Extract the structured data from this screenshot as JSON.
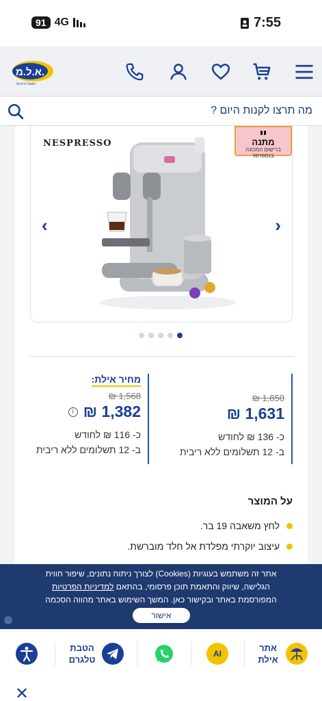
{
  "status_bar": {
    "battery": "91",
    "network": "4G",
    "time": "7:55"
  },
  "header": {
    "logo_text": "א.ל.מ.",
    "logo_subtext": "חשמל ודיגיטל",
    "brand_color": "#1a3f96",
    "accent_color": "#f3c200"
  },
  "search": {
    "placeholder": "מה תרצו לקנות היום ?"
  },
  "product": {
    "brand": "NESPRESSO",
    "gift_title": "מתנה",
    "gift_line1": "ברישום המכונה",
    "gift_line2": "בנספרסו!",
    "carousel_dots": 5,
    "active_dot": 4,
    "regular_price": {
      "old": "1,850 ₪",
      "new": "1,631 ₪",
      "monthly": "כ- 136 ₪ לחודש",
      "installments": "ב- 12 תשלומים ללא ריבית"
    },
    "eilat_price": {
      "label": "מחיר אילת:",
      "old": "1,568 ₪",
      "new": "1,382 ₪",
      "monthly": "כ- 116 ₪ לחודש",
      "installments": "ב- 12 תשלומים ללא ריבית"
    },
    "about_title": "על המוצר",
    "features": [
      "לחץ משאבה 19 בר.",
      "עיצוב יוקרתי מפלדת אל חלד מוברשת."
    ]
  },
  "cookie": {
    "text_part1": "אתר זה משתמש בעוגיות (Cookies) לצורך ניתוח נתונים, שיפור חווית הגלישה, שיווק והתאמת תוכן פרסומי, בהתאם",
    "link": "למדיניות הפרטיות",
    "text_part2": "המפורסמת באתר ובקישור כאן. המשך השימוש באתר מהווה הסכמה לכך.",
    "button": "אישור"
  },
  "bottom_bar": {
    "eilat_site": "אתר אילת",
    "ai": "AI",
    "telegram": "הטבת טלגרם"
  }
}
